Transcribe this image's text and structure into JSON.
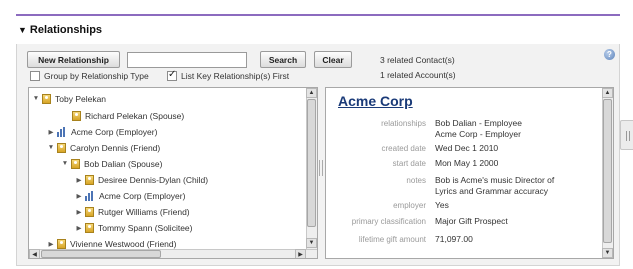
{
  "panel": {
    "title": "Relationships"
  },
  "toolbar": {
    "new_relationship_label": "New Relationship",
    "search_value": "",
    "search_label": "Search",
    "clear_label": "Clear",
    "group_by_label": "Group by Relationship Type",
    "group_by_checked": false,
    "list_key_label": "List Key Relationship(s) First",
    "list_key_checked": true,
    "related_contacts": "3 related Contact(s)",
    "related_accounts": "1 related Account(s)",
    "help_glyph": "?"
  },
  "tree": {
    "items": [
      {
        "label": "Toby Pelekan",
        "icon": "person-icon",
        "toggle": "▼"
      },
      {
        "label": "Richard Pelekan (Spouse)",
        "icon": "person-icon",
        "toggle": ""
      },
      {
        "label": "Acme Corp (Employer)",
        "icon": "organization-icon",
        "toggle": "▶"
      },
      {
        "label": "Carolyn Dennis (Friend)",
        "icon": "person-icon",
        "toggle": "▼"
      },
      {
        "label": "Bob Dalian (Spouse)",
        "icon": "person-icon",
        "toggle": "▼"
      },
      {
        "label": "Desiree Dennis-Dylan (Child)",
        "icon": "person-icon",
        "toggle": "▶"
      },
      {
        "label": "Acme Corp (Employer)",
        "icon": "organization-icon",
        "toggle": "▶"
      },
      {
        "label": "Rutger Williams (Friend)",
        "icon": "person-icon",
        "toggle": "▶"
      },
      {
        "label": "Tommy Spann (Solicitee)",
        "icon": "person-icon",
        "toggle": "▶"
      },
      {
        "label": "Vivienne Westwood (Friend)",
        "icon": "person-icon",
        "toggle": "▶"
      }
    ]
  },
  "detail": {
    "title": "Acme Corp",
    "fields": [
      {
        "label": "relationships",
        "value": [
          "Bob Dalian - Employee",
          "Acme Corp - Employer"
        ]
      },
      {
        "label": "created date",
        "value": [
          "Wed Dec 1 2010"
        ]
      },
      {
        "label": "start date",
        "value": [
          "Mon May 1 2000"
        ]
      },
      {
        "label": "notes",
        "value": [
          "Bob is Acme's music Director of",
          "Lyrics and Grammar accuracy"
        ]
      },
      {
        "label": "employer",
        "value": [
          "Yes"
        ]
      },
      {
        "label": "primary classification",
        "value": [
          "Major Gift Prospect"
        ]
      },
      {
        "label": "lifetime gift amount",
        "value": [
          "71,097.00"
        ]
      }
    ]
  },
  "colors": {
    "accent_line": "#8c6bbf",
    "detail_title": "#1a3a78"
  }
}
